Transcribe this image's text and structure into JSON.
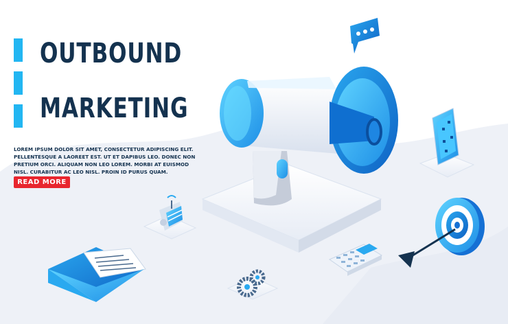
{
  "hero": {
    "title_line1": "OUTBOUND",
    "title_line2": "MARKETING",
    "body": "LOREM IPSUM DOLOR SIT AMET, CONSECTETUR ADIPISCING ELIT. PELLENTESQUE A LAOREET EST. UT ET DAPIBUS LEO. DONEC NON PRETIUM ORCI. ALIQUAM NON LEO LOREM. MORBI AT EUISMOD NISL. CURABITUR AC LEO NISL. PROIN ID PURUS QUAM.",
    "cta_label": "READ MORE"
  },
  "colors": {
    "title": "#14324f",
    "accent": "#22b6f2",
    "cta": "#e8262e",
    "backdrop": "#eef1f7"
  },
  "illustration": {
    "items": [
      "megaphone",
      "speech-bubble-icon",
      "smartphone",
      "target-with-arrow",
      "calculator",
      "gears",
      "server-rack",
      "envelope-with-letter"
    ]
  }
}
